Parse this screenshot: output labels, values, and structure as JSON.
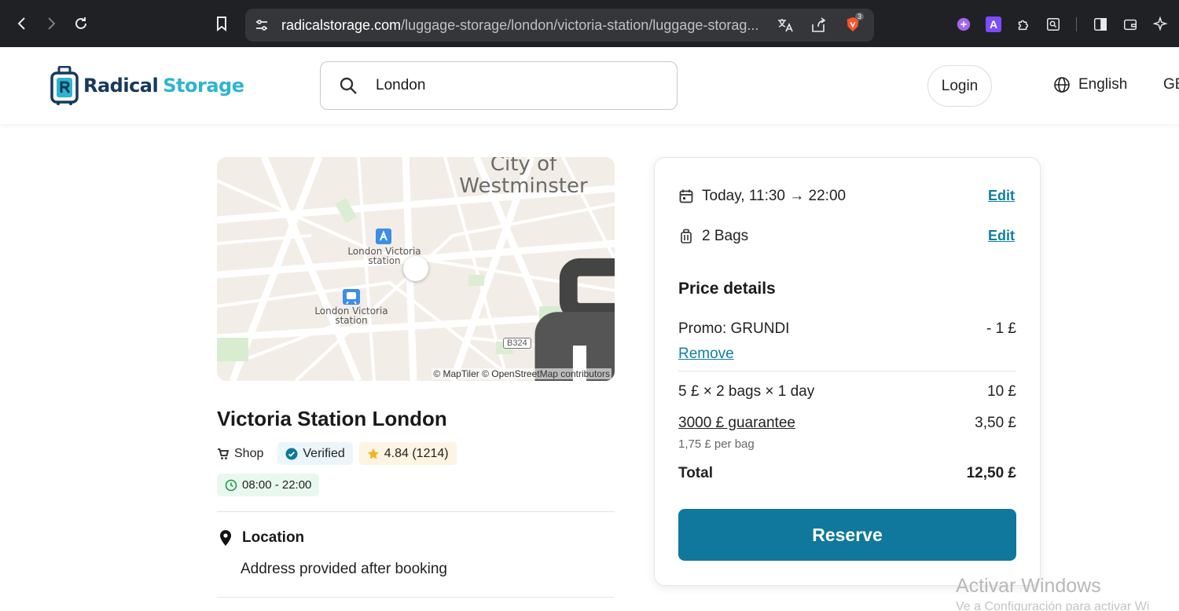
{
  "browser": {
    "url_host": "radicalstorage.com",
    "url_path": "/luggage-storage/london/victoria-station/luggage-storag...",
    "shield_count": "3",
    "ext_letter": "A"
  },
  "header": {
    "logo_word1": "Radical",
    "logo_word2": "Storage",
    "search_value": "London",
    "login_label": "Login",
    "language_label": "English",
    "currency_label": "GB"
  },
  "map": {
    "district_line1": "City of",
    "district_line2": "Westminster",
    "station1": "London Victoria station",
    "station2": "London Victoria station",
    "road": "B324",
    "credit": "© MapTiler © OpenStreetMap contributors"
  },
  "listing": {
    "title": "Victoria Station London",
    "category": "Shop",
    "verified": "Verified",
    "rating": "4.84 (1214)",
    "hours": "08:00 - 22:00",
    "location_title": "Location",
    "location_text": "Address provided after booking"
  },
  "booking": {
    "date_range": "Today, 11:30 → 22:00",
    "bags": "2 Bags",
    "edit_label": "Edit",
    "price_title": "Price details",
    "promo_label": "Promo: GRUNDI",
    "promo_value": "- 1 £",
    "remove_label": "Remove",
    "rate_label": "5 £ × 2 bags × 1 day",
    "rate_value": "10 £",
    "guarantee_label": "3000 £ guarantee",
    "guarantee_value": "3,50 £",
    "guarantee_sub": "1,75 £ per bag",
    "total_label": "Total",
    "total_value": "12,50 £",
    "reserve_label": "Reserve"
  },
  "os": {
    "watermark_line1": "Activar Windows",
    "watermark_line2": "Ve a Configuración para activar Wi"
  },
  "colors": {
    "accent": "#0f789c",
    "link": "#0e7fa1",
    "logo_dark": "#16395c",
    "logo_light": "#2cb5cf"
  }
}
